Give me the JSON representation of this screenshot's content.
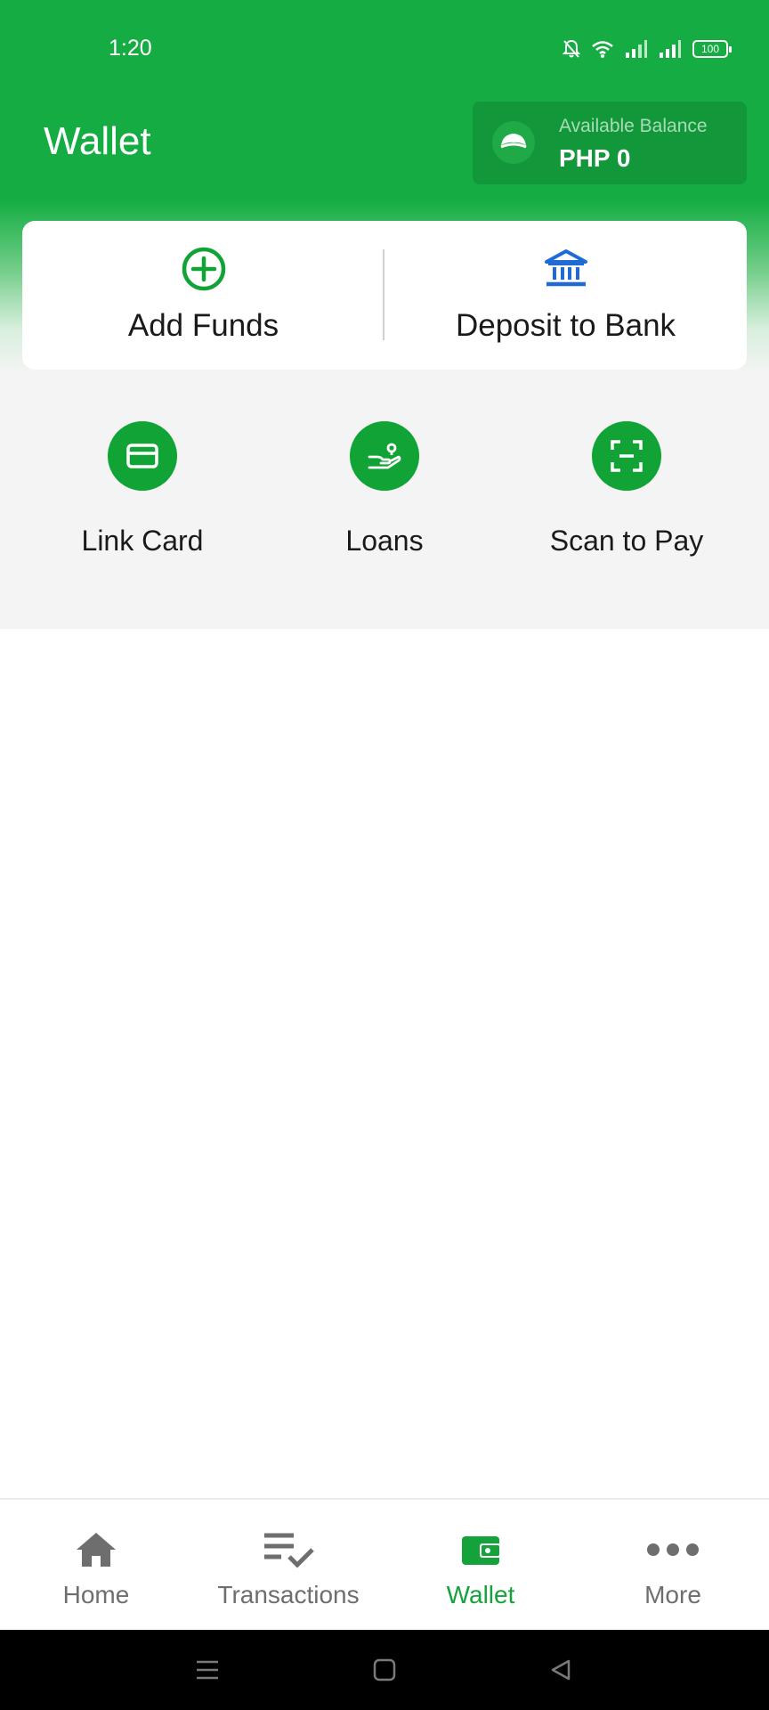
{
  "status_bar": {
    "time": "1:20",
    "battery": "100"
  },
  "header": {
    "title": "Wallet"
  },
  "balance": {
    "label": "Available Balance",
    "value": "PHP 0"
  },
  "actions": [
    {
      "label": "Add Funds",
      "icon": "plus-circle-icon"
    },
    {
      "label": "Deposit to Bank",
      "icon": "bank-icon"
    }
  ],
  "quick_actions": [
    {
      "label": "Link Card",
      "icon": "card-icon"
    },
    {
      "label": "Loans",
      "icon": "loan-hand-icon"
    },
    {
      "label": "Scan to Pay",
      "icon": "scan-icon"
    }
  ],
  "bottom_nav": {
    "active": "Wallet",
    "items": [
      {
        "label": "Home",
        "icon": "home-icon"
      },
      {
        "label": "Transactions",
        "icon": "transactions-icon"
      },
      {
        "label": "Wallet",
        "icon": "wallet-icon"
      },
      {
        "label": "More",
        "icon": "more-dots-icon"
      }
    ]
  },
  "colors": {
    "brand_green": "#15ad43",
    "deposit_blue": "#1e6bd6",
    "inactive_gray": "#6e6e6e"
  }
}
